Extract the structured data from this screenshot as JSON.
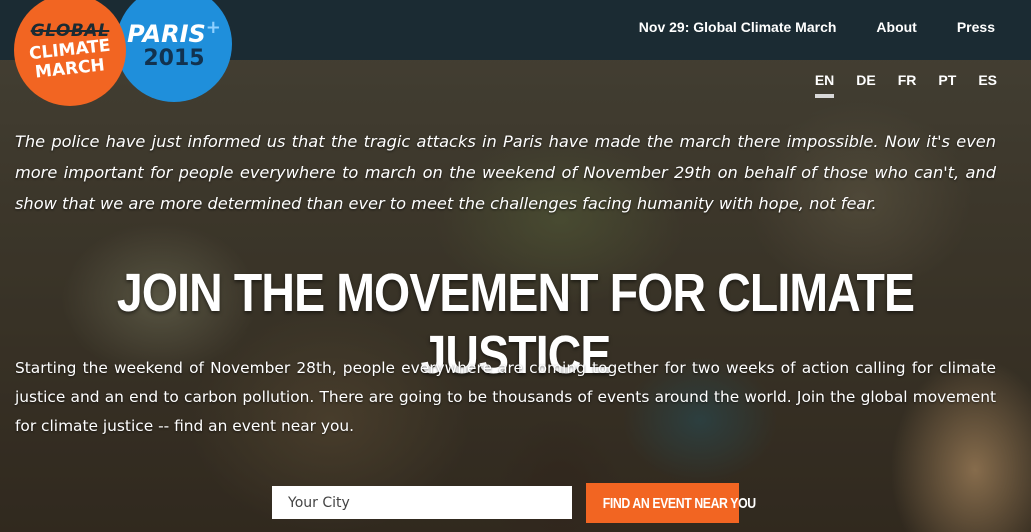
{
  "logos": {
    "global_climate_march": [
      "GLOBAL",
      "CLIMATE",
      "MARCH"
    ],
    "paris": {
      "line1": "PARIS",
      "plus": "+",
      "line2": "2015"
    }
  },
  "nav": {
    "items": [
      "Nov 29: Global Climate March",
      "About",
      "Press"
    ]
  },
  "languages": {
    "items": [
      "EN",
      "DE",
      "FR",
      "PT",
      "ES"
    ],
    "active": "EN"
  },
  "notice": "The police have just informed us that the tragic attacks in Paris have made the march there impossible. Now it's even more important for people everywhere to march on the weekend of November 29th on behalf of those who can't, and show that we are more determined than ever to meet the challenges facing humanity with hope, not fear.",
  "headline": "JOIN THE MOVEMENT FOR CLIMATE JUSTICE",
  "intro": "Starting the weekend of November 28th, people everywhere are coming together for two weeks of action calling for climate justice and an end to carbon pollution. There are going to be thousands of events around the world. Join the global movement for climate justice -- find an event near you.",
  "search": {
    "placeholder": "Your City",
    "button_label": "FIND AN EVENT NEAR YOU"
  },
  "colors": {
    "topbar": "#1b2b33",
    "accent_orange": "#f26522",
    "accent_blue": "#1f8fdb"
  }
}
